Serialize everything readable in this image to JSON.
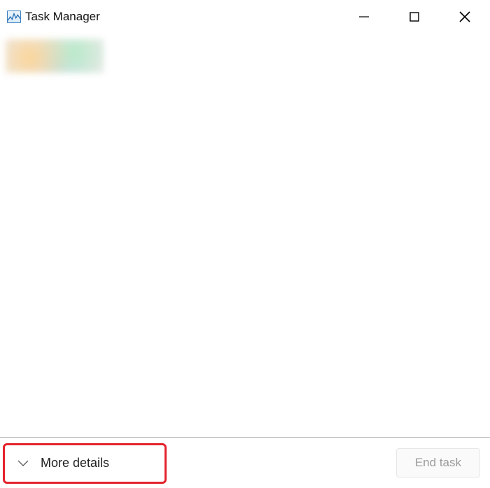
{
  "titlebar": {
    "app_title": "Task Manager"
  },
  "footer": {
    "more_details_label": "More details",
    "end_task_label": "End task"
  }
}
